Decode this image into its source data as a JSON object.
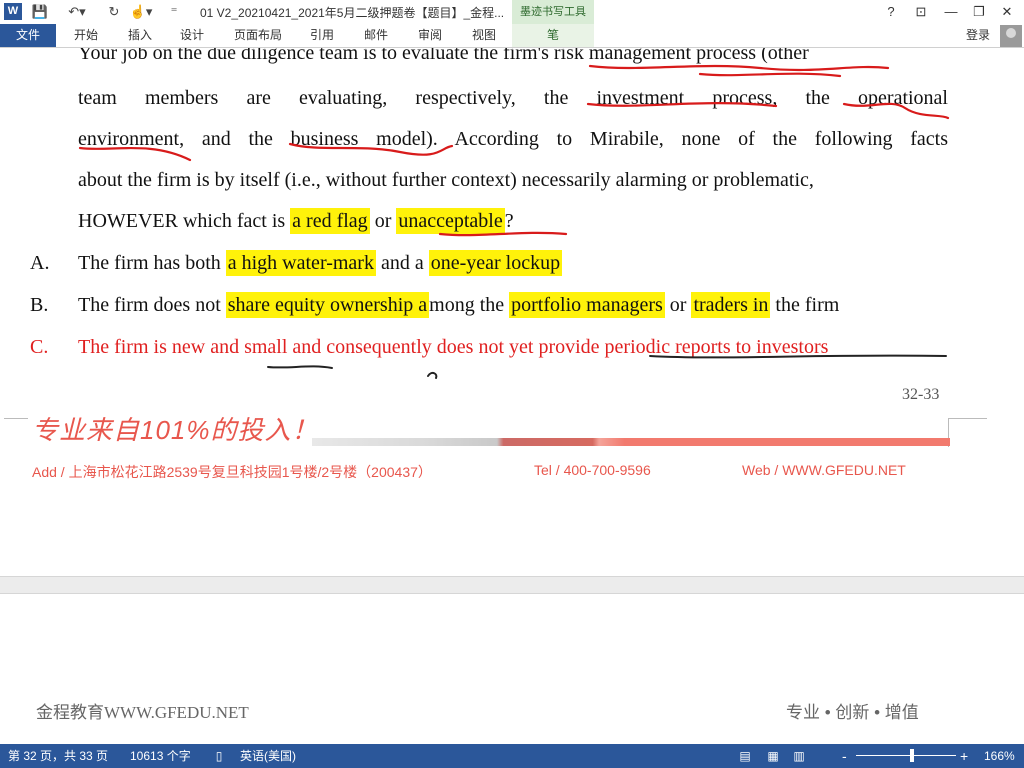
{
  "titlebar": {
    "app_icon": "W",
    "qa_save": "💾",
    "qa_undo": "↶▾",
    "qa_redo": "↻",
    "qa_touch": "☝▾",
    "qa_more": "⁼",
    "title": "01 V2_20210421_2021年5月二级押题卷【题目】_金程...",
    "tool_group": "墨迹书写工具",
    "help": "?",
    "ribbon_display": "⊡",
    "minimize": "—",
    "restore": "❐",
    "close": "✕"
  },
  "ribbon": {
    "file": "文件",
    "tabs": [
      "开始",
      "插入",
      "设计",
      "页面布局",
      "引用",
      "邮件",
      "审阅",
      "视图"
    ],
    "pen": "笔",
    "login": "登录"
  },
  "document": {
    "line0": "Your job on the due diligence team is to evaluate the firm's risk management process (other",
    "line1": "team members are evaluating, respectively, the investment process, the operational",
    "line2": "environment, and the business model). According to Mirabile, none of the following facts",
    "line3": "about the firm is by itself (i.e., without further context) necessarily alarming or problematic,",
    "line4_a": "HOWEVER which fact is ",
    "line4_hl1": "a red flag",
    "line4_b": " or ",
    "line4_hl2": "unacceptable",
    "line4_c": "?",
    "optA_letter": "A.",
    "optA_a": "The firm has both ",
    "optA_hl1": "a high water-mark",
    "optA_b": " and a ",
    "optA_hl2": "one-year lockup",
    "optB_letter": "B.",
    "optB_a": "The firm does not ",
    "optB_hl1": "share equity ownership a",
    "optB_b": "mong the ",
    "optB_hl2": "portfolio managers",
    "optB_c": " or ",
    "optB_hl3": "traders in",
    "optB_d": " the firm",
    "optC_letter": "C.",
    "optC_text": "The firm is new and small and consequently does not yet provide periodic reports to investors",
    "page_num": "32-33",
    "slogan": "专业来自101%的投入！",
    "address": "Add / 上海市松花江路2539号复旦科技园1号楼/2号楼（200437）",
    "tel": "Tel / 400-700-9596",
    "web": "Web / WWW.GFEDU.NET",
    "footer_left": "金程教育WWW.GFEDU.NET",
    "footer_right": "专业 • 创新 • 增值"
  },
  "statusbar": {
    "page": "第 32 页，共 33 页",
    "words": "10613 个字",
    "proof_icon": "▯",
    "language": "英语(美国)",
    "view_read": "▤",
    "view_print": "▦",
    "view_web": "▥",
    "zoom_out": "-",
    "zoom_in": "+",
    "zoom": "166%"
  },
  "colors": {
    "accent": "#2b579a",
    "highlight": "#fff20a",
    "answer_red": "#e02020",
    "ink_red": "#d81b1b",
    "brand_orange": "#e8574d"
  }
}
